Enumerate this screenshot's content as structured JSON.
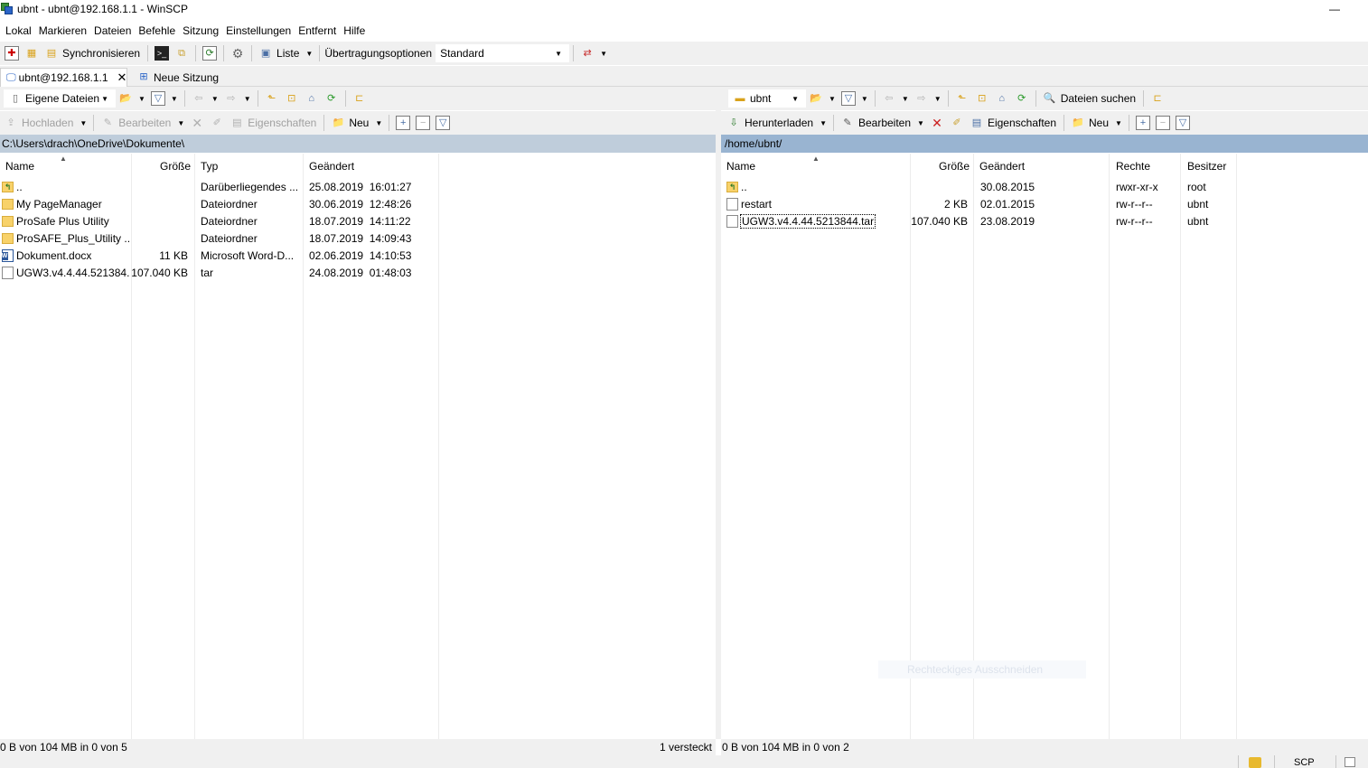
{
  "window": {
    "title": "ubnt - ubnt@192.168.1.1 - WinSCP",
    "minimize_glyph": "—"
  },
  "menu": [
    "Lokal",
    "Markieren",
    "Dateien",
    "Befehle",
    "Sitzung",
    "Einstellungen",
    "Entfernt",
    "Hilfe"
  ],
  "main_toolbar": {
    "sync_label": "Synchronisieren",
    "list_label": "Liste",
    "transfer_label": "Übertragungsoptionen",
    "transfer_value": "Standard"
  },
  "tabs": [
    {
      "label": "ubnt@192.168.1.1",
      "active": true
    },
    {
      "label": "Neue Sitzung",
      "active": false
    }
  ],
  "tab_close_glyph": "✕",
  "left_panel": {
    "location": "Eigene Dateien",
    "upload_label": "Hochladen",
    "edit_label": "Bearbeiten",
    "properties_label": "Eigenschaften",
    "new_label": "Neu",
    "path": "C:\\Users\\drach\\OneDrive\\Dokumente\\",
    "columns": [
      "Name",
      "Größe",
      "Typ",
      "Geändert"
    ],
    "files": [
      {
        "icon": "up",
        "name": "..",
        "size": "",
        "type": "Darüberliegendes ...",
        "modified": "25.08.2019  16:01:27"
      },
      {
        "icon": "folder",
        "name": "My PageManager",
        "size": "",
        "type": "Dateiordner",
        "modified": "30.06.2019  12:48:26"
      },
      {
        "icon": "folder",
        "name": "ProSafe Plus Utility",
        "size": "",
        "type": "Dateiordner",
        "modified": "18.07.2019  14:11:22"
      },
      {
        "icon": "folder",
        "name": "ProSAFE_Plus_Utility ...",
        "size": "",
        "type": "Dateiordner",
        "modified": "18.07.2019  14:09:43"
      },
      {
        "icon": "word",
        "name": "Dokument.docx",
        "size": "11 KB",
        "type": "Microsoft Word-D...",
        "modified": "02.06.2019  14:10:53"
      },
      {
        "icon": "file",
        "name": "UGW3.v4.4.44.521384...",
        "size": "107.040 KB",
        "type": "tar",
        "modified": "24.08.2019  01:48:03"
      }
    ],
    "status": "0 B von 104 MB in 0 von 5",
    "hidden": "1 versteckt"
  },
  "right_panel": {
    "location": "ubnt",
    "search_label": "Dateien suchen",
    "download_label": "Herunterladen",
    "edit_label": "Bearbeiten",
    "properties_label": "Eigenschaften",
    "new_label": "Neu",
    "path": "/home/ubnt/",
    "columns": [
      "Name",
      "Größe",
      "Geändert",
      "Rechte",
      "Besitzer"
    ],
    "files": [
      {
        "icon": "up",
        "name": "..",
        "size": "",
        "modified": "30.08.2015",
        "rights": "rwxr-xr-x",
        "owner": "root"
      },
      {
        "icon": "file",
        "name": "restart",
        "size": "2 KB",
        "modified": "02.01.2015",
        "rights": "rw-r--r--",
        "owner": "ubnt"
      },
      {
        "icon": "file",
        "name": "UGW3.v4.4.44.5213844.tar",
        "size": "107.040 KB",
        "modified": "23.08.2019",
        "rights": "rw-r--r--",
        "owner": "ubnt"
      }
    ],
    "status": "0 B von 104 MB in 0 von 2"
  },
  "ghost_tooltip": "Rechteckiges Ausschneiden",
  "protocol": "SCP"
}
